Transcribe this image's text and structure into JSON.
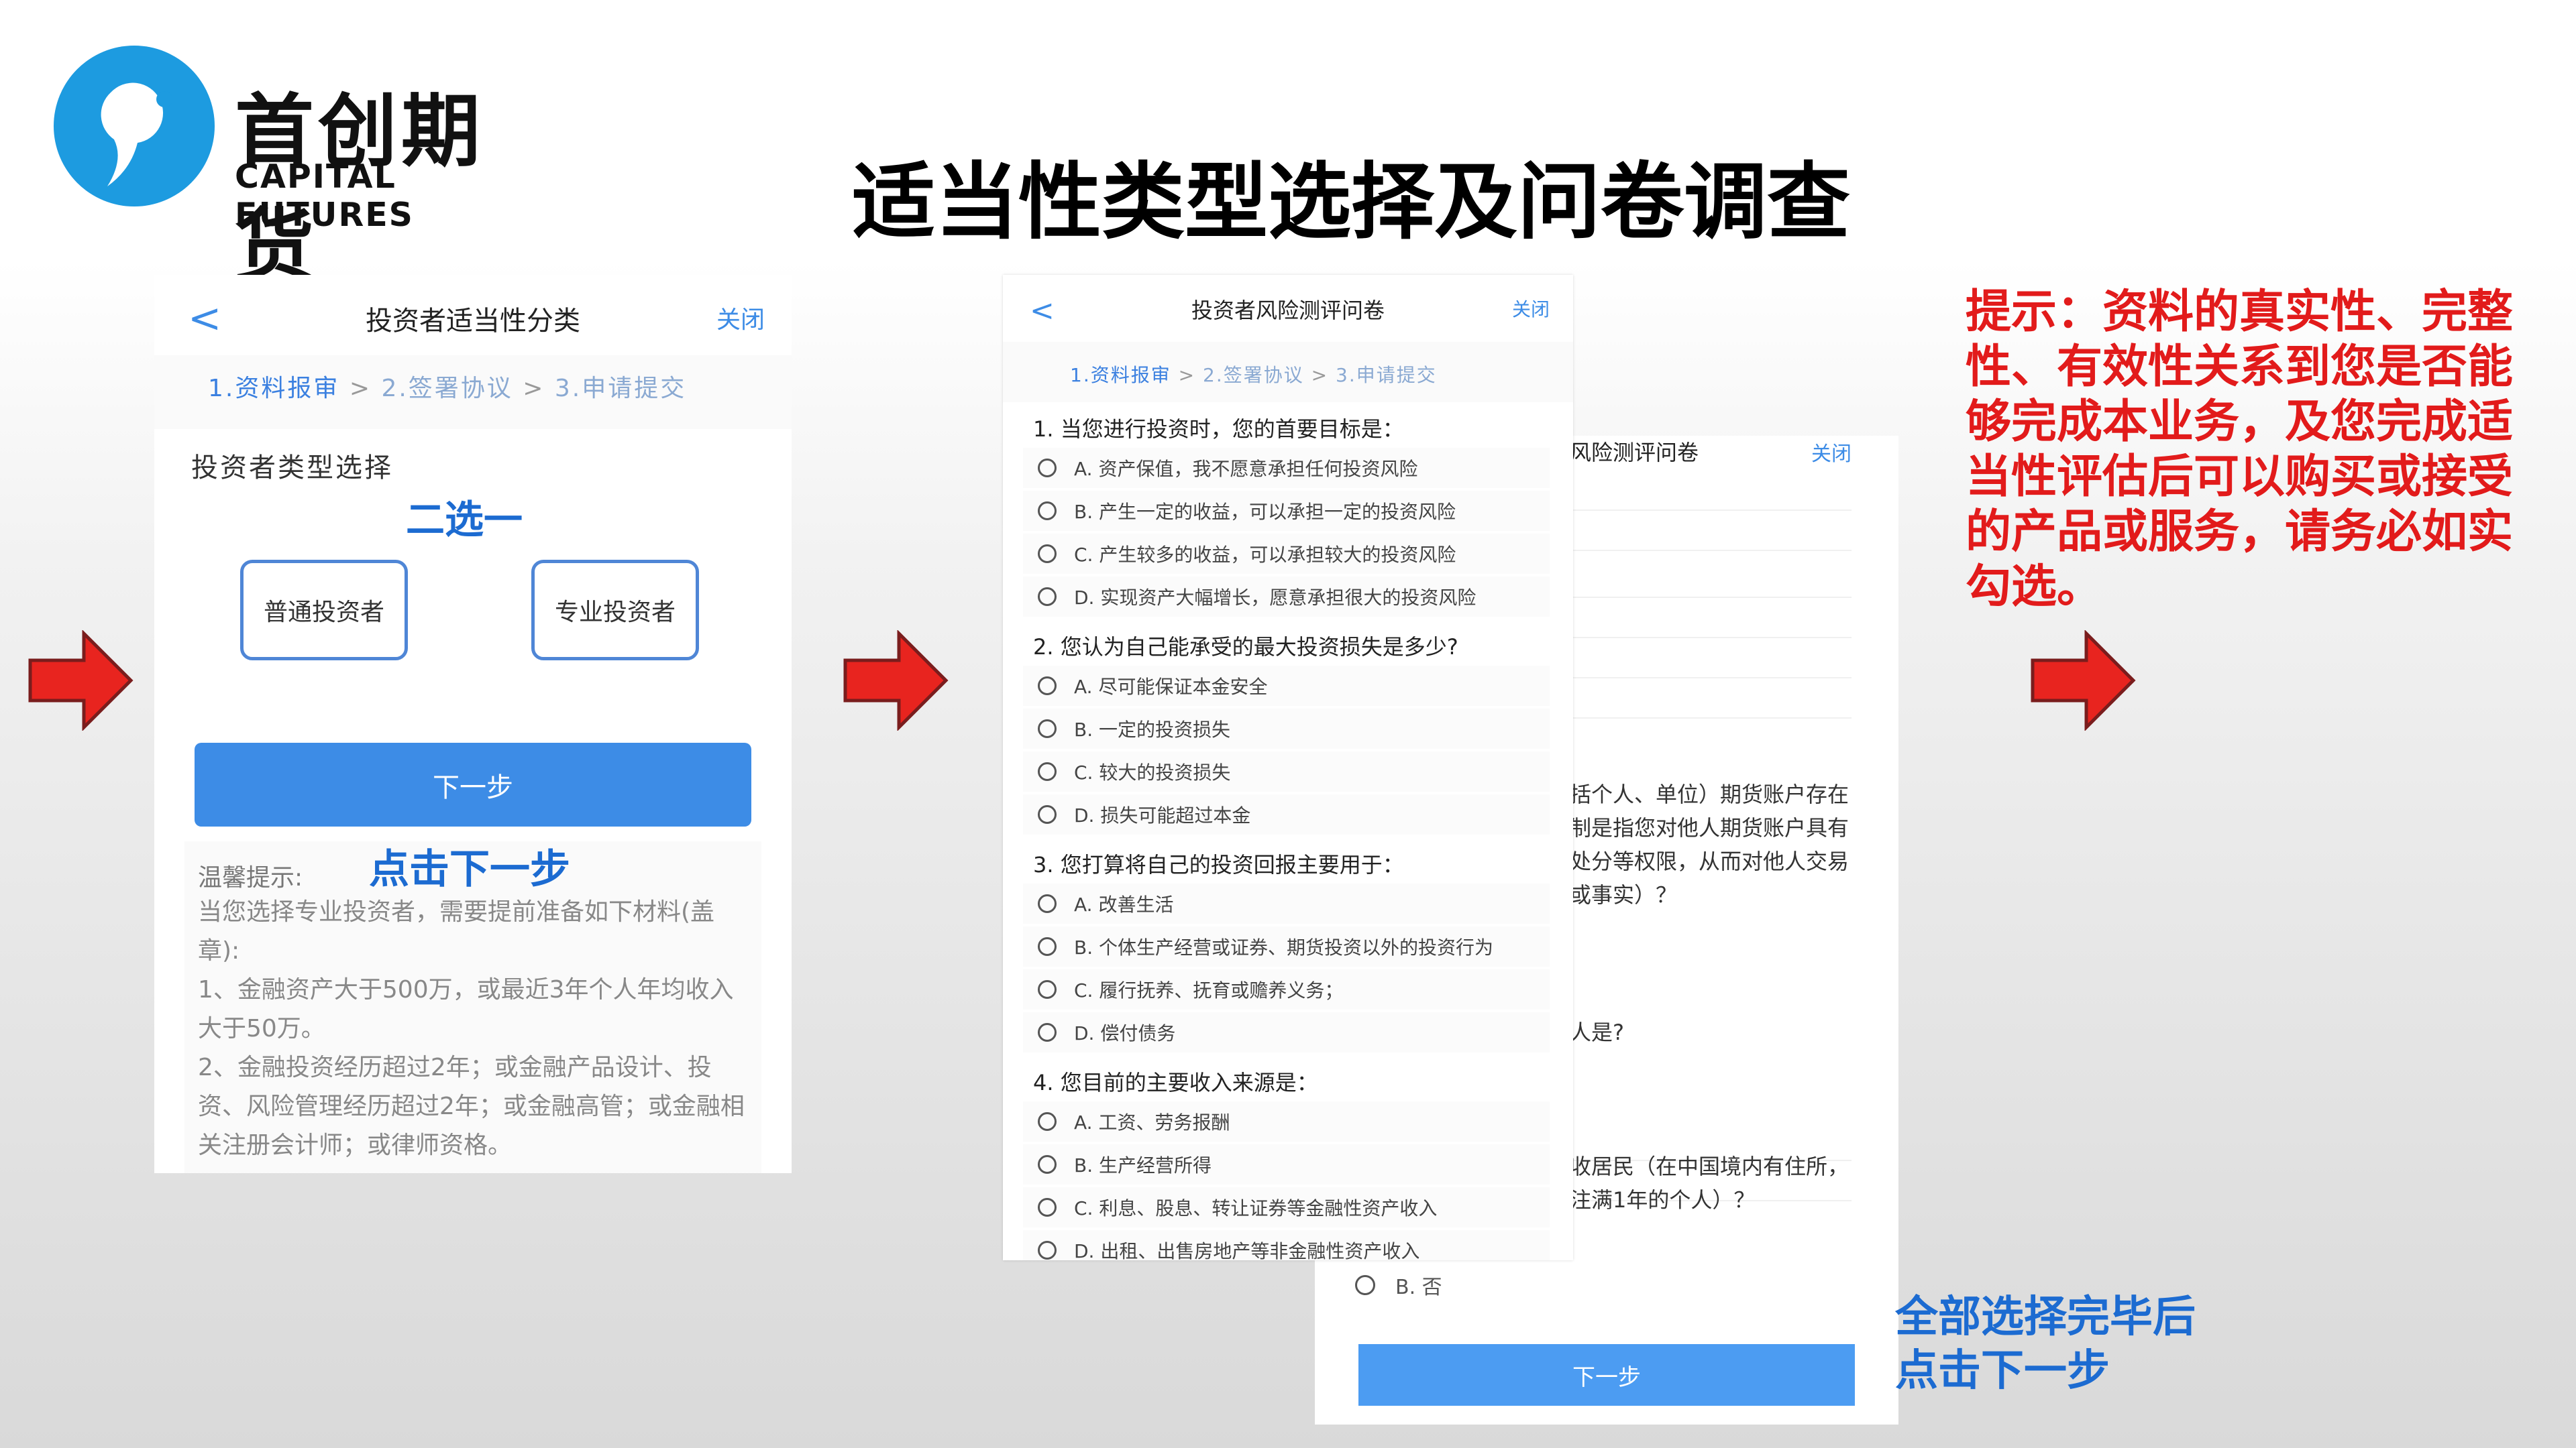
{
  "brand": {
    "name_cn": "首创期货",
    "name_en": "CAPITAL FUTURES"
  },
  "slide_title": "适当性类型选择及问卷调查",
  "colors": {
    "accent_blue": "#3d8ce6",
    "annotation_blue": "#1c6bd1",
    "tip_red": "#e21b1b",
    "arrow_red": "#e8241f"
  },
  "phone1": {
    "back": "<",
    "title": "投资者适当性分类",
    "close": "关闭",
    "steps": [
      "1.资料报审",
      "2.签署协议",
      "3.申请提交"
    ],
    "step_sep": ">",
    "section_title": "投资者类型选择",
    "annotation_pick": "二选一",
    "option_normal": "普通投资者",
    "option_pro": "专业投资者",
    "next_button": "下一步",
    "annotation_next": "点击下一步",
    "tip_label": "温馨提示:",
    "tip_lines": [
      "当您选择专业投资者，需要提前准备如下材料(盖章):",
      "1、金融资产大于500万，或最近3年个人年均收入大于50万。",
      "2、金融投资经历超过2年；或金融产品设计、投资、风险管理经历超过2年；或金融高管；或金融相关注册会计师；或律师资格。"
    ]
  },
  "phone2": {
    "back": "<",
    "title": "投资者风险测评问卷",
    "close": "关闭",
    "steps": [
      "1.资料报审",
      "2.签署协议",
      "3.申请提交"
    ],
    "step_sep": ">",
    "questions": [
      {
        "q": "1. 当您进行投资时，您的首要目标是：",
        "options": [
          "A.  资产保值，我不愿意承担任何投资风险",
          "B.  产生一定的收益，可以承担一定的投资风险",
          "C.  产生较多的收益，可以承担较大的投资风险",
          "D.  实现资产大幅增长，愿意承担很大的投资风险"
        ]
      },
      {
        "q": "2. 您认为自己能承受的最大投资损失是多少?",
        "options": [
          "A.  尽可能保证本金安全",
          "B.  一定的投资损失",
          "C.  较大的投资损失",
          "D.  损失可能超过本金"
        ]
      },
      {
        "q": "3. 您打算将自己的投资回报主要用于：",
        "options": [
          "A.  改善生活",
          "B.  个体生产经营或证券、期货投资以外的投资行为",
          "C.  履行抚养、抚育或赡养义务；",
          "D.  偿付债务"
        ]
      },
      {
        "q": "4. 您目前的主要收入来源是：",
        "options": [
          "A. 工资、劳务报酬",
          "B. 生产经营所得",
          "C. 利息、股息、转让证券等金融性资产收入",
          "D. 出租、出售房地产等非金融性资产收入"
        ]
      }
    ]
  },
  "phone3": {
    "title_fragment": "风险测评问卷",
    "close": "关闭",
    "text_fragments": [
      "括个人、单位）期货账户存在",
      "制是指您对他人期货账户具有",
      "处分等权限，从而对他人交易",
      "或事实）？",
      "人是?",
      "收居民（在中国境内有住所，",
      "注满1年的个人）？"
    ],
    "option_b": "B. 否",
    "next_button": "下一步"
  },
  "red_tip": "提示：资料的真实性、完整性、有效性关系到您是否能够完成本业务，及您完成适当性评估后可以购买或接受的产品或服务，请务必如实勾选。",
  "annotation_final_lines": [
    "全部选择完毕后",
    "点击下一步"
  ]
}
